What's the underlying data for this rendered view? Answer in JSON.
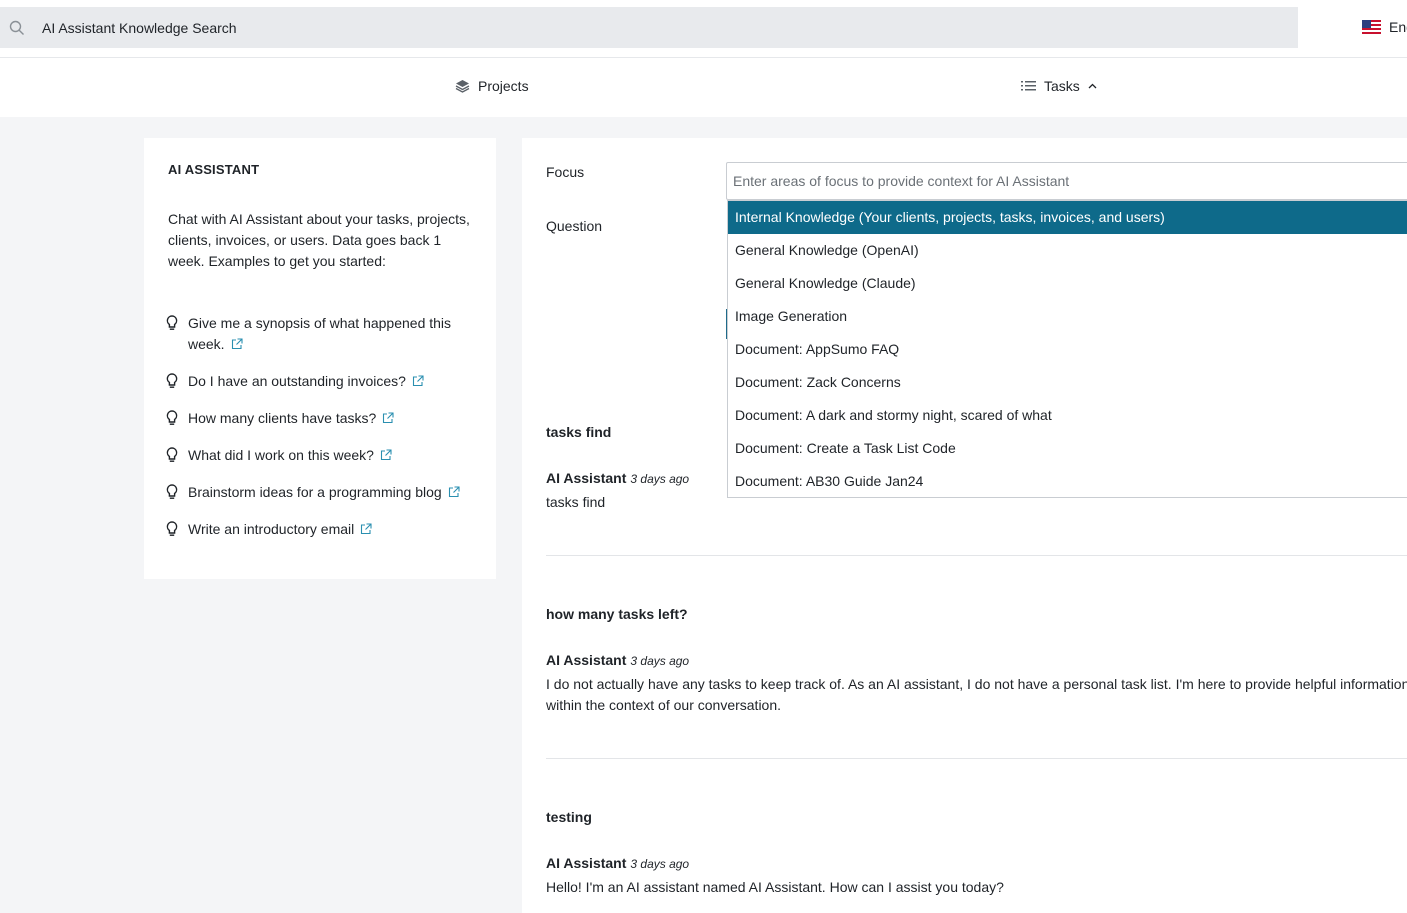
{
  "search": {
    "value": "AI Assistant Knowledge Search"
  },
  "language": {
    "label": "Eng"
  },
  "nav": {
    "projects": "Projects",
    "tasks": "Tasks"
  },
  "sidebar": {
    "title": "AI ASSISTANT",
    "intro": "Chat with AI Assistant about your tasks, projects, clients, invoices, or users. Data goes back 1 week. Examples to get you started:",
    "examples": [
      "Give me a synopsis of what happened this week.",
      "Do I have an outstanding invoices?",
      "How many clients have tasks?",
      "What did I work on this week?",
      "Brainstorm ideas for a programming blog",
      "Write an introductory email"
    ]
  },
  "form": {
    "focus_label": "Focus",
    "focus_placeholder": "Enter areas of focus to provide context for AI Assistant",
    "question_label": "Question"
  },
  "dropdown": {
    "options": [
      "Internal Knowledge (Your clients, projects, tasks, invoices, and users)",
      "General Knowledge (OpenAI)",
      "General Knowledge (Claude)",
      "Image Generation",
      "Document: AppSumo FAQ",
      "Document: Zack Concerns",
      "Document: A dark and stormy night, scared of what",
      "Document: Create a Task List Code",
      "Document: AB30 Guide Jan24"
    ],
    "highlighted_index": 0
  },
  "conversation": [
    {
      "question": "tasks find",
      "author": "AI Assistant",
      "time": "3 days ago",
      "answer": "tasks find"
    },
    {
      "question": "how many tasks left?",
      "author": "AI Assistant",
      "time": "3 days ago",
      "answer": "I do not actually have any tasks to keep track of. As an AI assistant, I do not have a personal task list. I'm here to provide helpful information within the context of our conversation."
    },
    {
      "question": "testing",
      "author": "AI Assistant",
      "time": "3 days ago",
      "answer": "Hello! I'm an AI assistant named AI Assistant. How can I assist you today?"
    }
  ],
  "colors": {
    "accent": "#0e6a8a",
    "link_icon": "#2a8fb0",
    "background": "#f4f5f7"
  }
}
